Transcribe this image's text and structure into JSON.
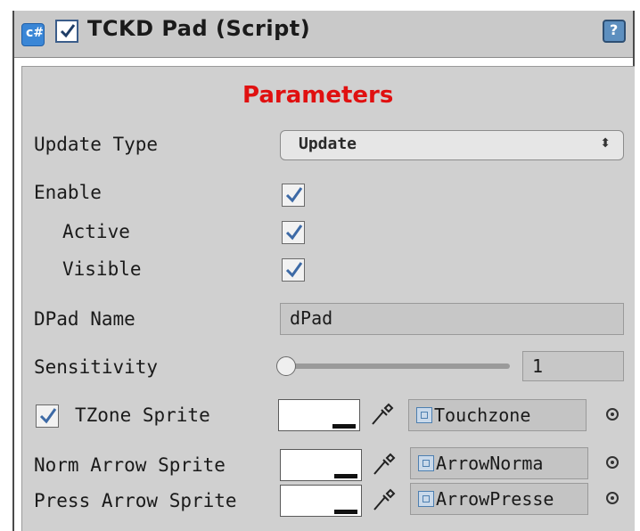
{
  "component": {
    "title": "TCKD Pad (Script)",
    "enabled": true,
    "icon": "csharp-script-icon",
    "help_icon": "help-icon"
  },
  "section": {
    "title": "Parameters",
    "title_color": "#e01010"
  },
  "fields": {
    "update_type": {
      "label": "Update Type",
      "value": "Update"
    },
    "enable": {
      "label": "Enable",
      "checked": true
    },
    "active": {
      "label": "Active",
      "checked": true
    },
    "visible": {
      "label": "Visible",
      "checked": true
    },
    "dpad_name": {
      "label": "DPad Name",
      "value": "dPad"
    },
    "sensitivity": {
      "label": "Sensitivity",
      "value": "1"
    },
    "tzone_sprite": {
      "label": "TZone Sprite",
      "checked": true,
      "object": "Touchzone"
    },
    "norm_arrow_sprite": {
      "label": "Norm Arrow Sprite",
      "object": "ArrowNorma"
    },
    "press_arrow_sprite": {
      "label": "Press Arrow Sprite",
      "object": "ArrowPresse"
    }
  }
}
